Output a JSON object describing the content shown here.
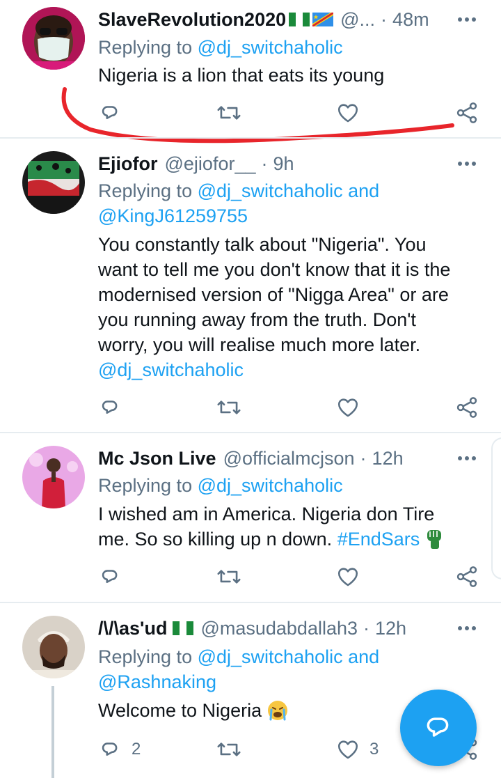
{
  "tweets": [
    {
      "name": "SlaveRevolution2020",
      "handle": "@...",
      "dot": "·",
      "time": "48m",
      "replying_label": "Replying to",
      "replying_to": "@dj_switchaholic",
      "replying_and": "",
      "replying_to_2": "",
      "body": "Nigeria is a lion that eats its young",
      "reply_count": "",
      "like_count": ""
    },
    {
      "name": "Ejiofor",
      "handle": "@ejiofor__",
      "dot": "·",
      "time": "9h",
      "replying_label": "Replying to",
      "replying_to": "@dj_switchaholic",
      "replying_and": "and",
      "replying_to_2": "@KingJ61259755",
      "body_line1": "You constantly talk about \"Nigeria\". You",
      "body_line2": "want to tell me you don't know that it is the",
      "body_line3": "modernised version of \"Nigga Area\" or are",
      "body_line4": "you running away from the truth. Don't",
      "body_line5": "worry, you will realise much more later.",
      "body_mention": "@dj_switchaholic",
      "reply_count": "",
      "like_count": ""
    },
    {
      "name": "Mc Json Live",
      "handle": "@officialmcjson",
      "dot": "·",
      "time": "12h",
      "replying_label": "Replying to",
      "replying_to": "@dj_switchaholic",
      "body_line1": "I wished am in America. Nigeria don Tire",
      "body_line2": "me. So so killing up n down.",
      "hashtag": "#EndSars",
      "reply_count": "",
      "like_count": ""
    },
    {
      "name": "/\\/\\as'ud",
      "handle": "@masudabdallah3",
      "dot": "·",
      "time": "12h",
      "replying_label": "Replying to",
      "replying_to": "@dj_switchaholic",
      "replying_and": "and",
      "replying_to_2": "@Rashnaking",
      "body": "Welcome to Nigeria",
      "reply_count": "2",
      "like_count": "3"
    }
  ],
  "icons": {
    "reply": "reply-icon",
    "retweet": "retweet-icon",
    "like": "like-icon",
    "share": "share-icon",
    "more": "more-icon",
    "compose": "compose-reply-icon"
  },
  "colors": {
    "accent": "#1da1f2",
    "secondary_text": "#5b7083",
    "annotation": "#e8252b"
  }
}
